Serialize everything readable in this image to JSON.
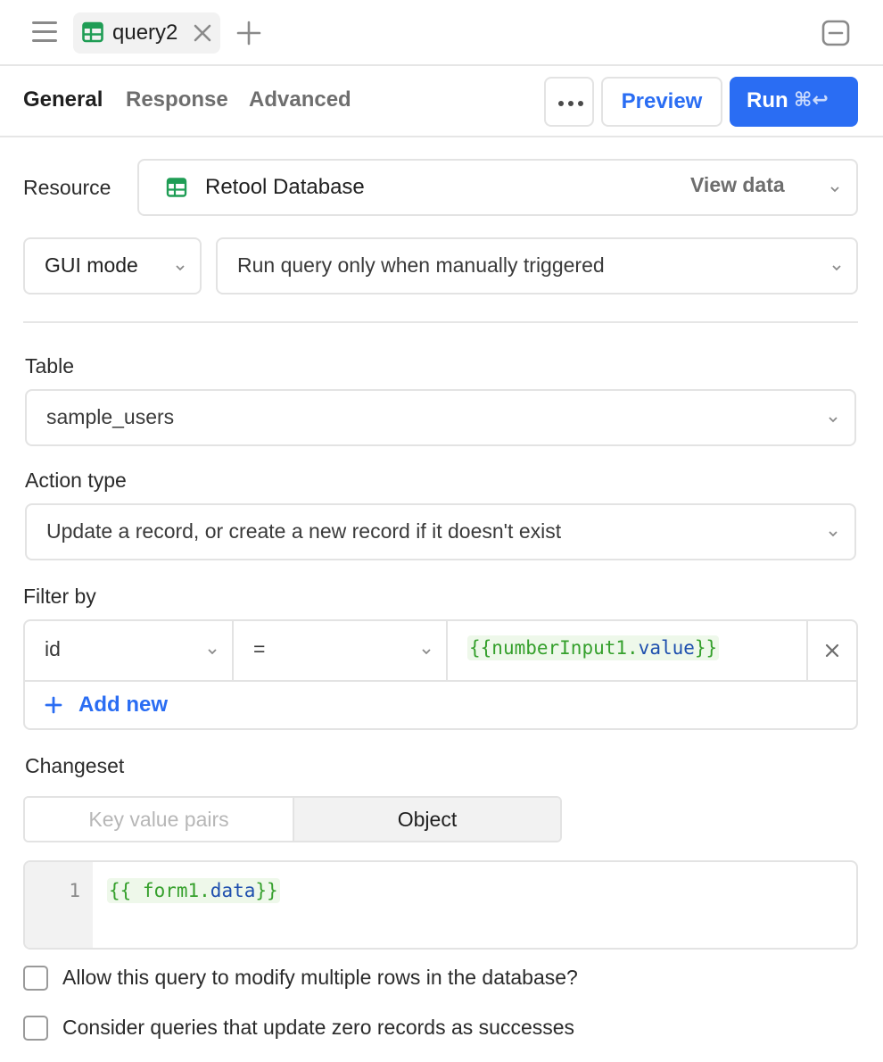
{
  "tabbar": {
    "query_tab_label": "query2"
  },
  "subtabs": {
    "general": "General",
    "response": "Response",
    "advanced": "Advanced"
  },
  "actions": {
    "preview_label": "Preview",
    "run_label": "Run",
    "run_shortcut": "⌘↩"
  },
  "resource": {
    "label": "Resource",
    "value": "Retool Database",
    "view_data_label": "View data"
  },
  "mode": {
    "value": "GUI mode",
    "trigger_value": "Run query only when manually triggered"
  },
  "table": {
    "label": "Table",
    "value": "sample_users"
  },
  "action_type": {
    "label": "Action type",
    "value": "Update a record, or create a new record if it doesn't exist"
  },
  "filter": {
    "label": "Filter by",
    "rows": [
      {
        "column": "id",
        "operator": "=",
        "value_prefix": "{{",
        "value_object": "numberInput1.",
        "value_prop": "value",
        "value_suffix": "}}"
      }
    ],
    "add_new_label": "Add new"
  },
  "changeset": {
    "label": "Changeset",
    "options": [
      "Key value pairs",
      "Object"
    ],
    "selected": "Object",
    "editor": {
      "line_number": "1",
      "code_prefix": "{{ form1.",
      "code_prop": "data",
      "code_suffix": "}}"
    }
  },
  "options": {
    "multiple_rows_label": "Allow this query to modify multiple rows in the database?",
    "multiple_rows_checked": false,
    "zero_records_label": "Consider queries that update zero records as successes",
    "zero_records_checked": false
  },
  "colors": {
    "accent": "#2a6df3",
    "table_icon": "#1f9d55",
    "code_green": "#35a02c",
    "code_blue": "#1e4fae"
  }
}
